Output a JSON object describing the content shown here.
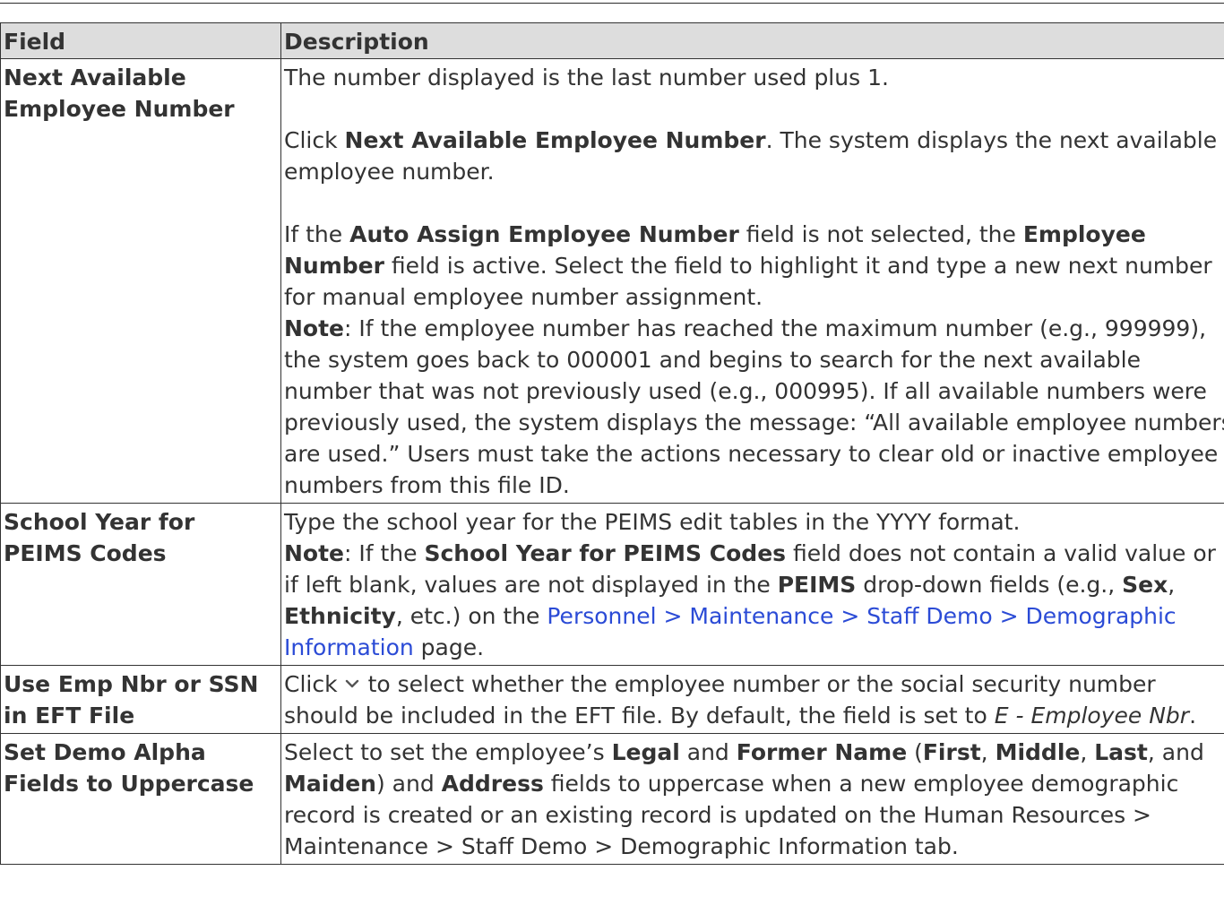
{
  "table": {
    "headers": [
      "Field",
      "Description"
    ],
    "rows": [
      {
        "field": "Next Available Employee Number",
        "p1": "The number displayed is the last number used plus 1.",
        "p2_pre": "Click ",
        "p2_bold": "Next Available Employee Number",
        "p2_post": ". The system displays the next available employee number.",
        "p3_pre": "If the ",
        "p3_b1": "Auto Assign Employee Number",
        "p3_mid": " field is not selected, the ",
        "p3_b2": "Employee Number",
        "p3_post": " field is active. Select the field to highlight it and type a new next number for manual employee number assignment.",
        "note_label": "Note",
        "note_text": ": If the employee number has reached the maximum number (e.g., 999999), the system goes back to 000001 and begins to search for the next available number that was not previously used (e.g., 000995). If all available numbers were previously used, the system displays the message: “All available employee numbers are used.” Users must take the actions necessary to clear old or inactive employee numbers from this file ID."
      },
      {
        "field": "School Year for PEIMS Codes",
        "p1": "Type the school year for the PEIMS edit tables in the YYYY format.",
        "note_label": "Note",
        "n1": ": If the ",
        "n_b1": "School Year for PEIMS Codes",
        "n2": " field does not contain a valid value or if left blank, values are not displayed in the ",
        "n_b2": "PEIMS",
        "n3": " drop-down fields (e.g., ",
        "n_b3": "Sex",
        "n4": ", ",
        "n_b4": "Ethnicity",
        "n5": ", etc.) on the ",
        "link": "Personnel > Maintenance > Staff Demo > Demographic Information",
        "n6": " page."
      },
      {
        "field": "Use Emp Nbr or SSN in EFT File",
        "pre": "Click",
        "icon": "chevron-down-icon",
        "post": "to select whether the employee number or the social security number should be included in the EFT file. By default, the field is set to ",
        "italic": "E - Employee Nbr",
        "end": "."
      },
      {
        "field": "Set Demo Alpha Fields to Uppercase",
        "t1": "Select to set the employee’s ",
        "b1": "Legal",
        "t2": " and ",
        "b2": "Former Name",
        "t3": " (",
        "b3": "First",
        "t4": ", ",
        "b4": "Middle",
        "t5": ", ",
        "b5": "Last",
        "t6": ", and ",
        "b6": "Maiden",
        "t7": ") and ",
        "b7": "Address",
        "t8": " fields to uppercase when a new employee demographic record is created or an existing record is updated on the Human Resources > Maintenance > Staff Demo > Demographic Information tab."
      }
    ]
  },
  "colors": {
    "link": "#2b4bd6",
    "header_bg": "#dddddd",
    "border": "#333333"
  }
}
